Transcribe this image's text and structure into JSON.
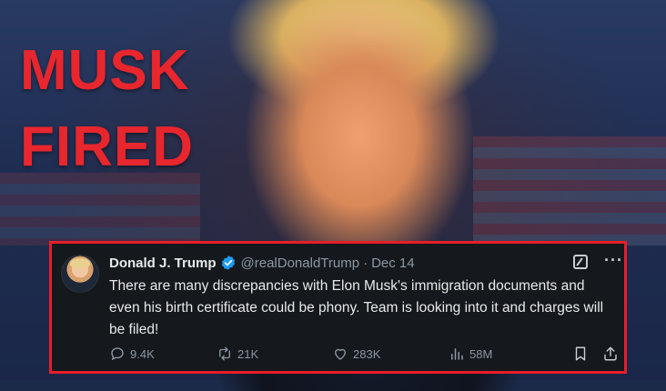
{
  "headline": {
    "line1": "MUSK",
    "line2": "FIRED"
  },
  "tweet": {
    "author_name": "Donald J. Trump",
    "handle": "@realDonaldTrump",
    "separator": "·",
    "date": "Dec 14",
    "text": "There are many discrepancies with Elon Musk's immigration documents and even his birth certificate could be phony. Team is looking into it and charges will be filed!",
    "more_icon_text": "···",
    "actions": {
      "replies": "9.4K",
      "reposts": "21K",
      "likes": "283K",
      "views": "58M"
    }
  },
  "colors": {
    "headline": "#e8262e",
    "frame_border": "#e81d2a",
    "tweet_bg": "#15181c",
    "verified": "#1d9bf0",
    "muted_text": "#8b98a5"
  },
  "icons": [
    "verified-badge-icon",
    "grok-icon",
    "more-icon",
    "reply-icon",
    "repost-icon",
    "like-icon",
    "views-icon",
    "bookmark-icon",
    "share-icon"
  ]
}
